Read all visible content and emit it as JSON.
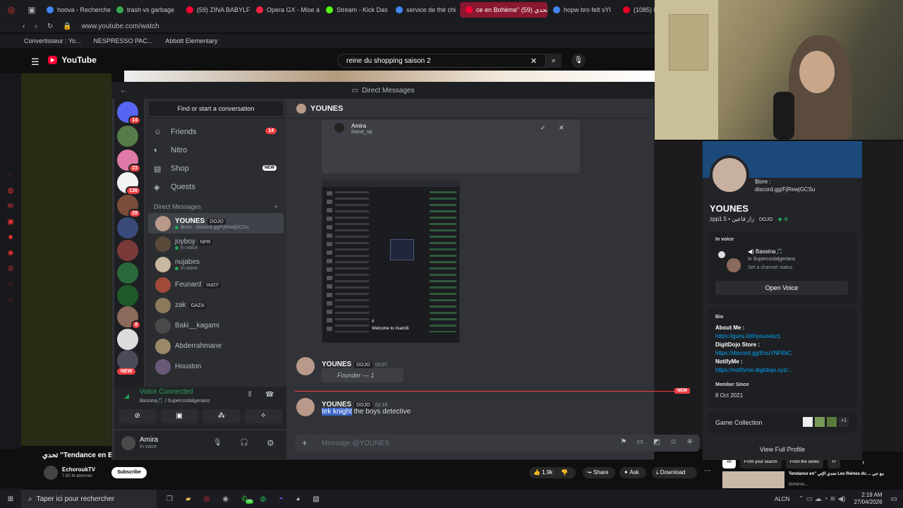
{
  "browser": {
    "tabs": [
      {
        "label": "hoova - Recherche",
        "color": "#4285f4"
      },
      {
        "label": "trash vs garbage",
        "color": "#34a853"
      },
      {
        "label": "(59) ZINA BABYLF",
        "color": "#ff0033"
      },
      {
        "label": "Opera GX - Mise à",
        "color": "#ff2244"
      },
      {
        "label": "Stream - Kick Das",
        "color": "#53fc18"
      },
      {
        "label": "service de thé chi",
        "color": "#4285f4"
      },
      {
        "label": "ce en Bohème\" تحدي (59)",
        "color": "#ff0033"
      },
      {
        "label": "hopw bro felt sYI",
        "color": "#4285f4"
      },
      {
        "label": "(1085) Pin",
        "color": "#e60023"
      }
    ],
    "url": "www.youtube.com/watch",
    "bookmarks": [
      "Convertisseur : Yo...",
      "NESPRESSO PAC...",
      "Abbott Elementary"
    ]
  },
  "youtube": {
    "logo": "YouTube",
    "search_query": "reine du shopping saison 2",
    "video_title": "تحدي \"Tendance en B",
    "channel": "EchoroukTV",
    "subscribers": "7,65 M abonnés",
    "subscribe_label": "Subscribe",
    "likes": "1,9k",
    "share_label": "Share",
    "ask_label": "Ask",
    "download_label": "Download",
    "filter_chips": [
      "All",
      "From your search",
      "From the series",
      "Fr"
    ],
    "related_title": "Tendance en\" تحدي الإتي Les Reines du ... مع جي",
    "related_sub": "Bohème..."
  },
  "discord": {
    "window_title": "Direct Messages",
    "search_placeholder": "Find or start a conversation",
    "nav": [
      {
        "label": "Friends",
        "icon": "friends-icon",
        "badge": "14"
      },
      {
        "label": "Nitro",
        "icon": "nitro-icon"
      },
      {
        "label": "Shop",
        "icon": "shop-icon",
        "tag": "NEW"
      },
      {
        "label": "Quests",
        "icon": "quests-icon"
      }
    ],
    "guild_badges": [
      "14",
      "",
      "23",
      "136",
      "29",
      "",
      "",
      "",
      "",
      "8",
      "",
      "",
      ""
    ],
    "dm_header": "Direct Messages",
    "dms": [
      {
        "name": "YOUNES",
        "tag": "DOJO",
        "status": "$tore : discord.gg/FjRewjGCSu",
        "selected": true
      },
      {
        "name": "joyboy",
        "tag": "NFR",
        "status": "In voice"
      },
      {
        "name": "nujabes",
        "tag": "",
        "status": "In voice"
      },
      {
        "name": "Feunard",
        "tag": "VoDY",
        "status": ""
      },
      {
        "name": "zak",
        "tag": "GAZA",
        "status": ""
      },
      {
        "name": "Baki__kagami",
        "tag": "",
        "status": ""
      },
      {
        "name": "Abderrahmane",
        "tag": "",
        "status": ""
      },
      {
        "name": "Houston",
        "tag": "",
        "status": ""
      }
    ],
    "new_label": "NEW",
    "voice": {
      "title": "Voice Connected",
      "channel": "Bassina🎵 / Supercoolalgerians"
    },
    "user": {
      "name": "Amira",
      "status": "In voice"
    },
    "chat": {
      "recipient": "YOUNES",
      "embed_name": "Amira",
      "embed_sub": "friend_rat",
      "screenshot_caption": "Welcome to #sam3i",
      "messages": [
        {
          "author": "YOUNES",
          "tag": "DOJO",
          "time": "02:07",
          "text": "Founder — 1"
        },
        {
          "author": "YOUNES",
          "tag": "DOJO",
          "time": "02:18",
          "highlight": "tek knight",
          "text": " the boys detective"
        }
      ],
      "new_divider": "NEW",
      "composer_placeholder": "Message @YOUNES"
    },
    "profile": {
      "status": "$tore : discord.gg/FjRewjGCSu",
      "name": "YOUNES",
      "handle": "zpp1.5 • زاز قاعين",
      "tag": "DOJO",
      "in_voice_label": "In voice",
      "voice_channel": "Bassina🎵",
      "voice_server": "in Supercoolalgerians",
      "voice_status": "Set a channel status",
      "open_voice": "Open Voice",
      "bio_label": "Bio",
      "bio": [
        {
          "label": "About Me :",
          "link": "https://guns.lol/hyounesz1"
        },
        {
          "label": "DigitDojo Store :",
          "link": "https://discord.gg/EnuYNFEkC"
        },
        {
          "label": "NotifyMe :",
          "link": "https://notifyme.digitdojo.xyz/..."
        }
      ],
      "member_since_label": "Member Since",
      "member_since": "8 Oct 2021",
      "game_collection": "Game Collection",
      "game_more": "+1",
      "view_full": "View Full Profile"
    }
  },
  "taskbar": {
    "search": "Taper ici pour rechercher",
    "weather": "ALCN",
    "time": "2:19 AM",
    "date": "27/04/2026",
    "badge": "20"
  }
}
